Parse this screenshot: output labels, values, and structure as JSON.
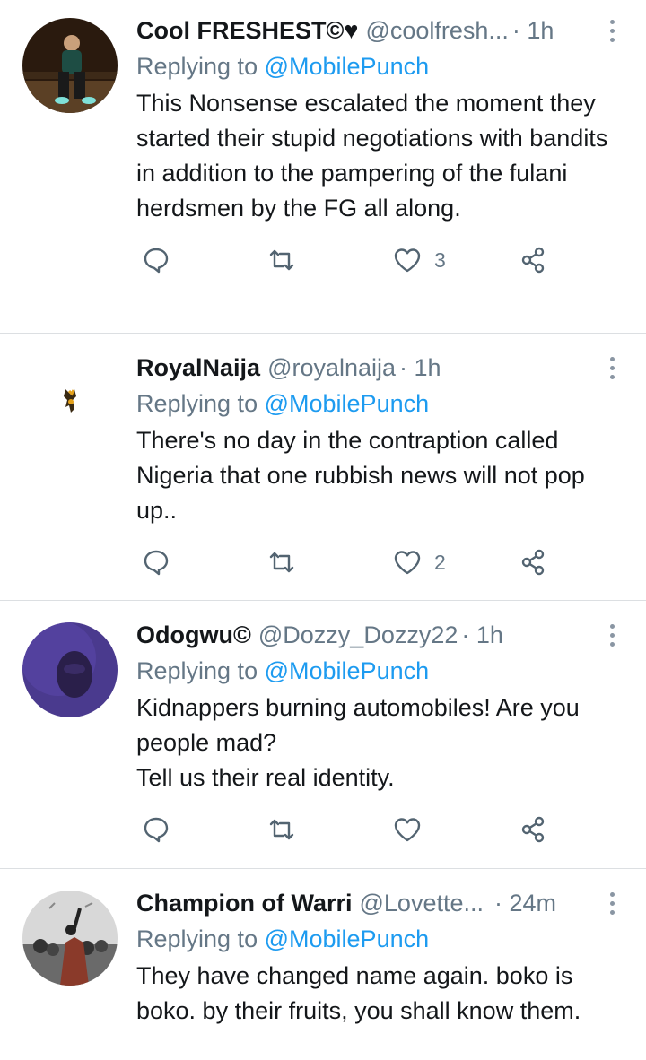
{
  "tweets": [
    {
      "name": "Cool FRESHEST©♥",
      "handle": "@coolfresh...",
      "time": "· 1h",
      "replying_prefix": "Replying to",
      "replying_to": "@MobilePunch",
      "text": "This Nonsense escalated the moment they started their stupid negotiations with bandits in addition to the pampering of the fulani herdsmen by the FG all along.",
      "likes": "3",
      "avatar_icon": "person-sitting-photo"
    },
    {
      "name": "RoyalNaija",
      "handle": "@royalnaija",
      "time": "· 1h",
      "replying_prefix": "Replying to",
      "replying_to": "@MobilePunch",
      "text": "There's no day in the contraption called Nigeria that one rubbish news will not pop up..",
      "likes": "2",
      "avatar_icon": "small-figure-logo"
    },
    {
      "name": "Odogwu©",
      "handle": "@Dozzy_Dozzy22",
      "time": "· 1h",
      "replying_prefix": "Replying to",
      "replying_to": "@MobilePunch",
      "text": "Kidnappers burning automobiles! Are you people mad?\nTell us their real identity.",
      "likes": "",
      "avatar_icon": "purple-portrait"
    },
    {
      "name": "Champion of Warri",
      "handle": "@Lovette...",
      "time": "· 24m",
      "replying_prefix": "Replying to",
      "replying_to": "@MobilePunch",
      "text": "They have changed name again. boko is boko. by their fruits, you shall know them.",
      "likes": "",
      "avatar_icon": "crowd-photo"
    }
  ],
  "colors": {
    "name": "#14171a",
    "muted": "#657786",
    "accent": "#1d9bf0",
    "divider": "#dcdfe2"
  }
}
